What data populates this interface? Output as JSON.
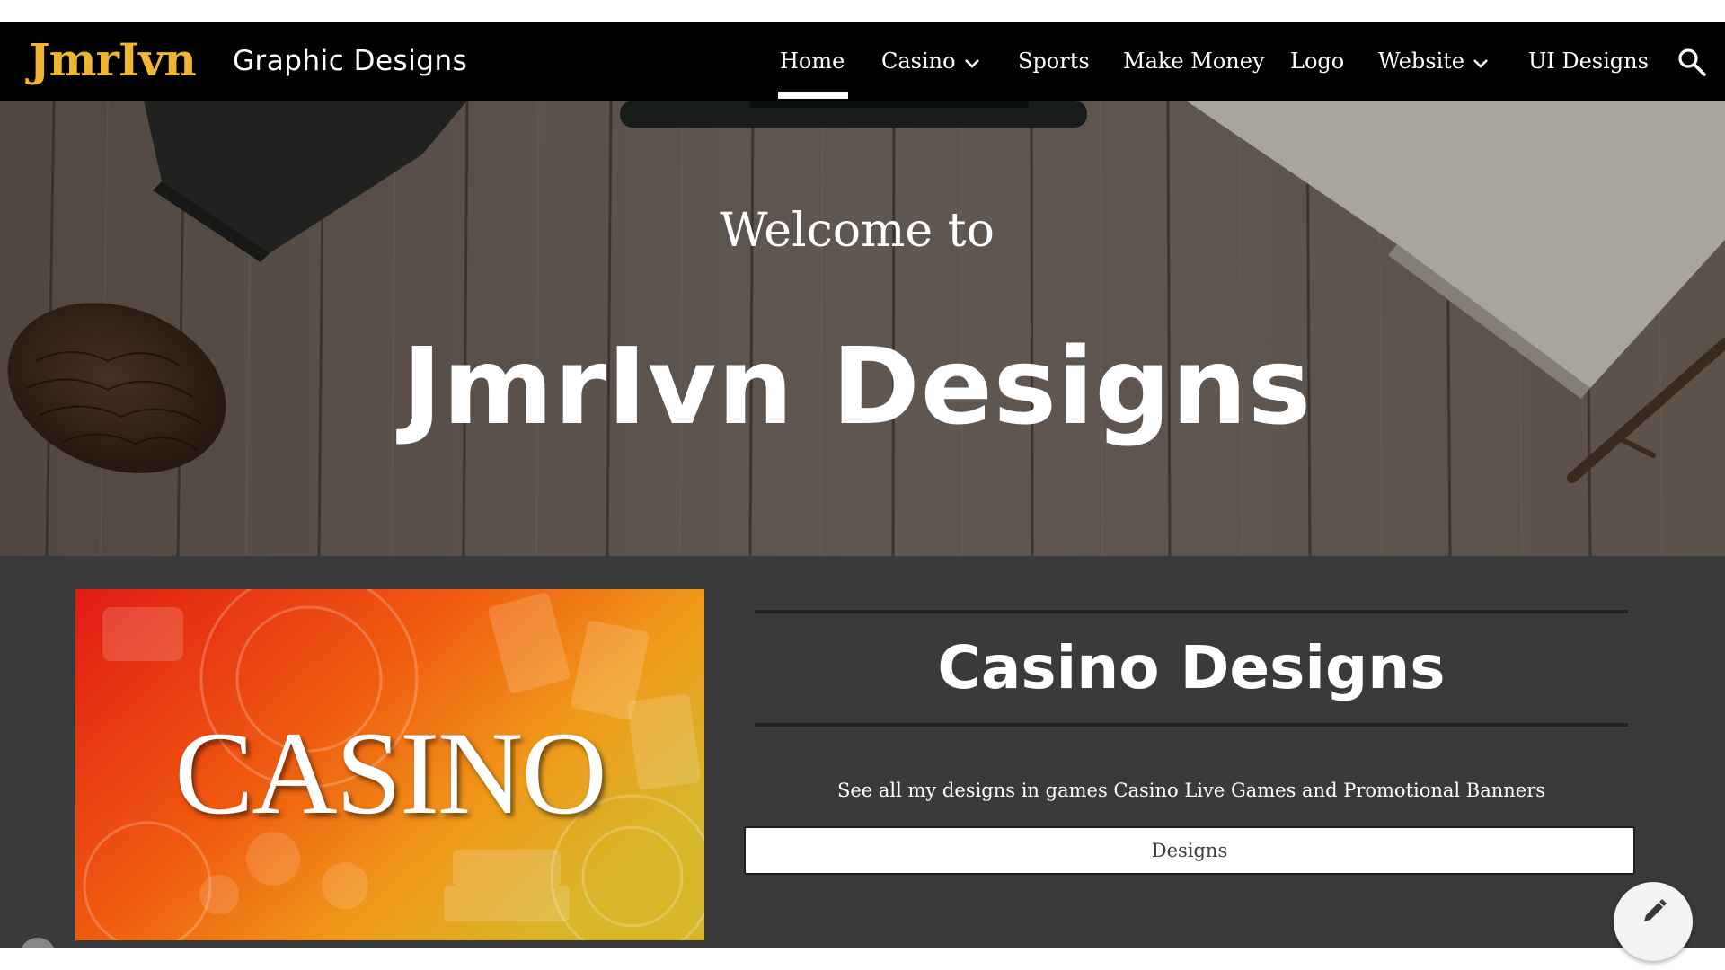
{
  "header": {
    "logo_text": "JmrIvn",
    "site_title": "Graphic Designs",
    "nav": [
      {
        "label": "Home",
        "active": true,
        "has_dropdown": false
      },
      {
        "label": "Casino",
        "active": false,
        "has_dropdown": true
      },
      {
        "label": "Sports",
        "active": false,
        "has_dropdown": false
      },
      {
        "label": "Make Money",
        "active": false,
        "has_dropdown": false
      },
      {
        "label": "Logo",
        "active": false,
        "has_dropdown": false
      },
      {
        "label": "Website",
        "active": false,
        "has_dropdown": true
      },
      {
        "label": "UI Designs",
        "active": false,
        "has_dropdown": false
      }
    ],
    "search_icon": "search-icon"
  },
  "hero": {
    "welcome": "Welcome to",
    "title": "JmrIvn Designs"
  },
  "section": {
    "image_text": "CASINO",
    "title": "Casino Designs",
    "description": "See all my designs in games Casino Live Games and Promotional Banners",
    "button_label": "Designs"
  },
  "fab": {
    "icon": "pencil-icon"
  },
  "colors": {
    "nav_bg": "#000000",
    "logo": "#f0b532",
    "content_bg": "#3a3a3a",
    "text": "#ffffff"
  }
}
